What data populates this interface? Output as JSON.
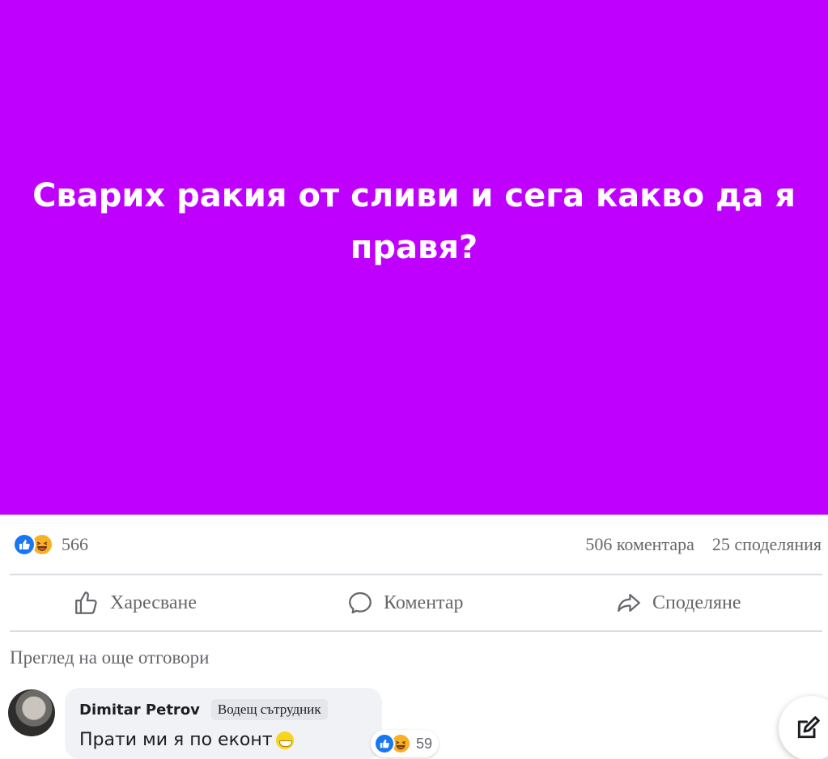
{
  "post": {
    "text": "Сварих ракия от сливи и сега какво да я правя?",
    "background_color": "#bf00ff"
  },
  "stats": {
    "reactions": [
      "like-icon",
      "haha-icon"
    ],
    "reaction_count": "566",
    "comments": "506 коментара",
    "shares": "25 споделяния"
  },
  "actions": {
    "like_label": "Харесване",
    "comment_label": "Коментар",
    "share_label": "Споделяне"
  },
  "more_replies": "Преглед на още отговори",
  "comment": {
    "author": "Dimitar Petrov",
    "badge": "Водещ сътрудник",
    "text": "Прати ми я по еконт",
    "emoji": "grinning-face-icon",
    "reaction_count": "59"
  },
  "colors": {
    "accent_blue": "#1877f2",
    "haha_yellow": "#f7b125",
    "secondary_text": "#65676b"
  }
}
